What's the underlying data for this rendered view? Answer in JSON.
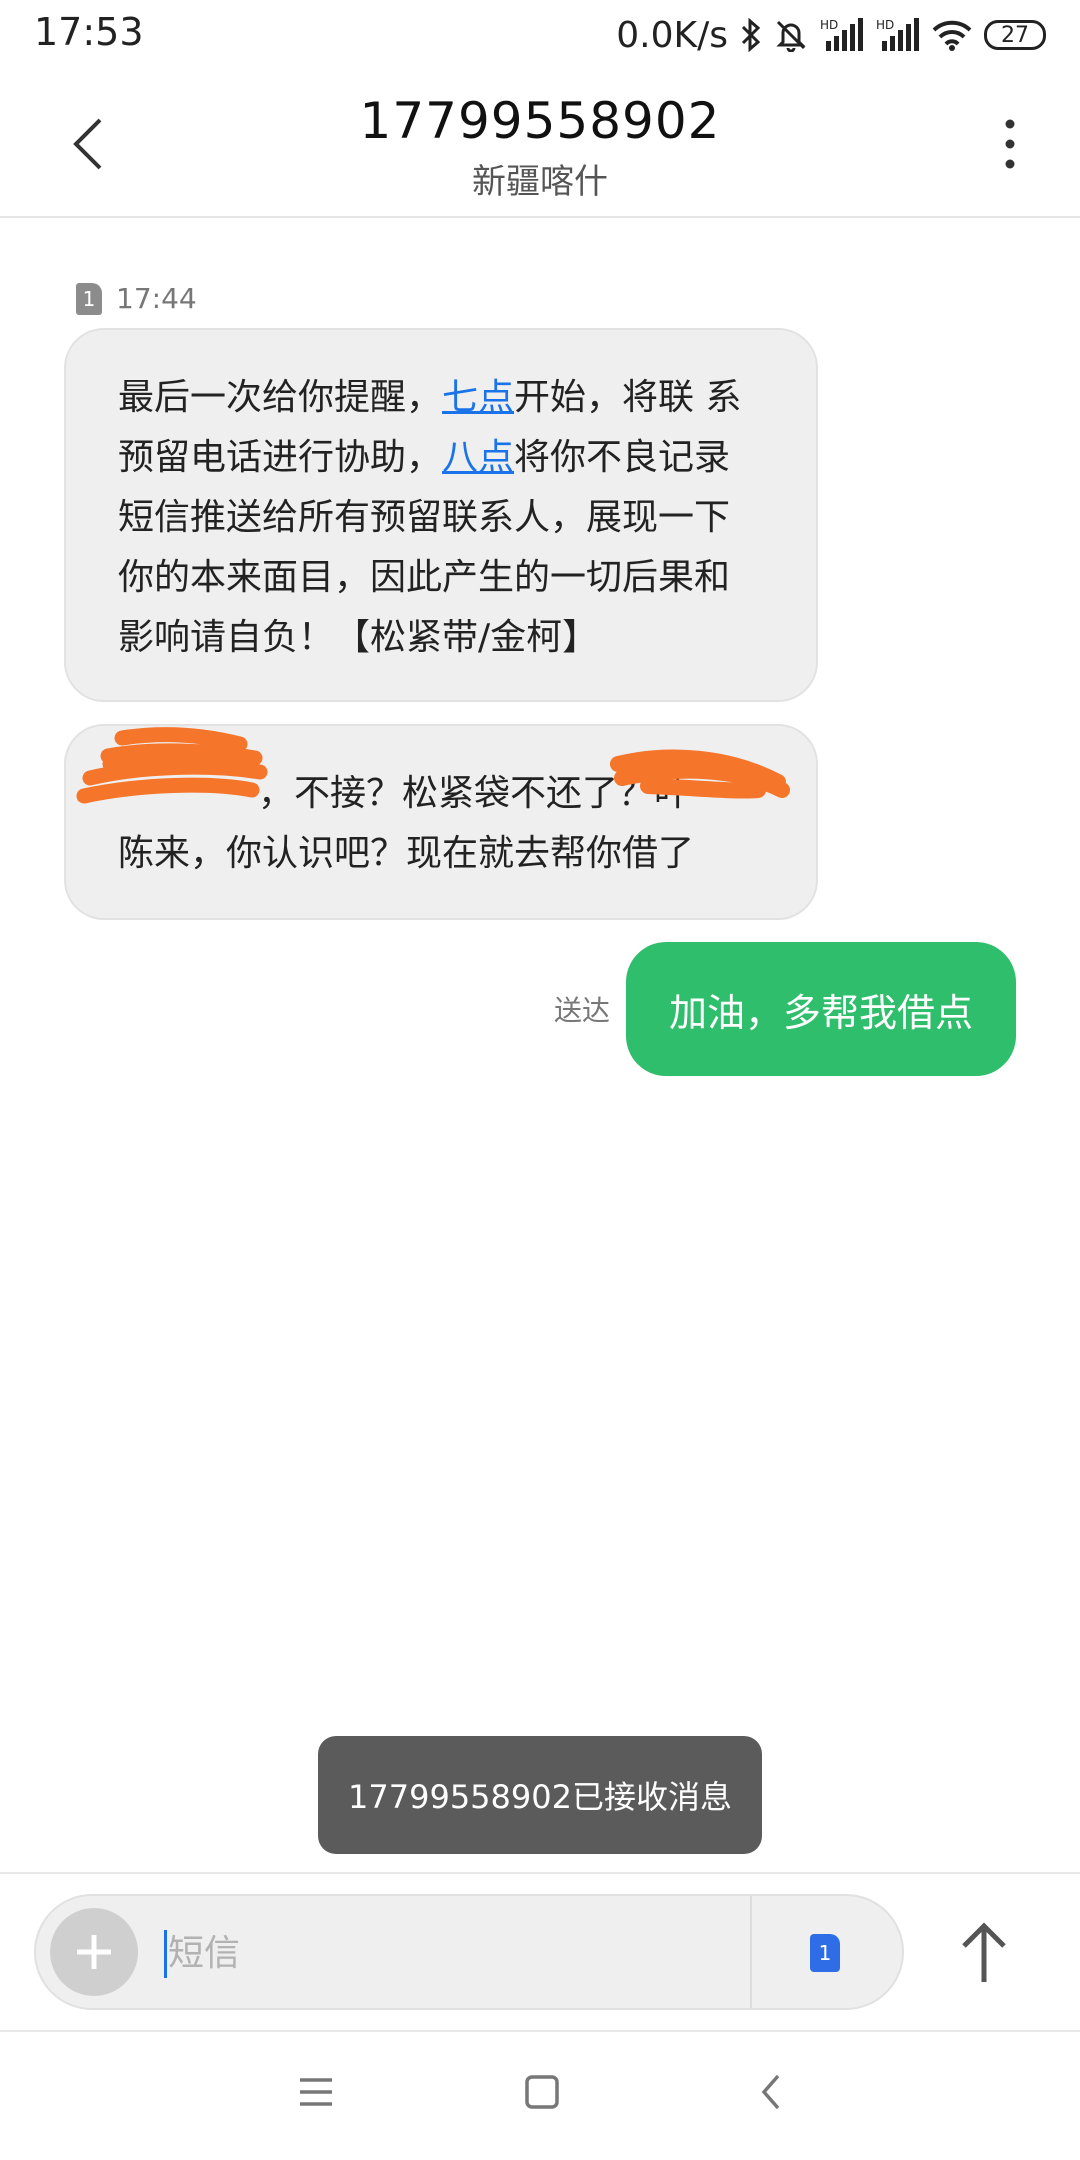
{
  "status_bar": {
    "time": "17:53",
    "net_speed": "0.0K/s",
    "battery": "27",
    "icons": [
      "bluetooth-icon",
      "mute-icon",
      "signal-hd-1-icon",
      "signal-hd-2-icon",
      "wifi-icon",
      "battery-icon"
    ]
  },
  "header": {
    "number": "17799558902",
    "location": "新疆喀什"
  },
  "messages": [
    {
      "sim": "1",
      "time": "17:44",
      "segments": [
        "最后一次给你提醒，",
        "七点",
        "开始，将联 系预留电话进行协助，",
        "八点",
        "将你不良记录短信推送给所有预留联系人，展现一下你的本来面目，因此产生的一切后果和影响请自负！【松紧带/金柯】"
      ]
    },
    {
      "line1": "，不接？松紧袋不还了？叶",
      "line2": "陈来，你认识吧？现在就去帮你借了"
    }
  ],
  "sent": {
    "status": "送达",
    "text": "加油，多帮我借点"
  },
  "toast": "17799558902已接收消息",
  "composer": {
    "placeholder": "短信",
    "value": "",
    "sim": "1"
  },
  "colors": {
    "accent": "#1a73e8",
    "sent_bubble": "#2fbe6b",
    "received_bubble": "#efefef",
    "redaction": "#f5752a"
  }
}
